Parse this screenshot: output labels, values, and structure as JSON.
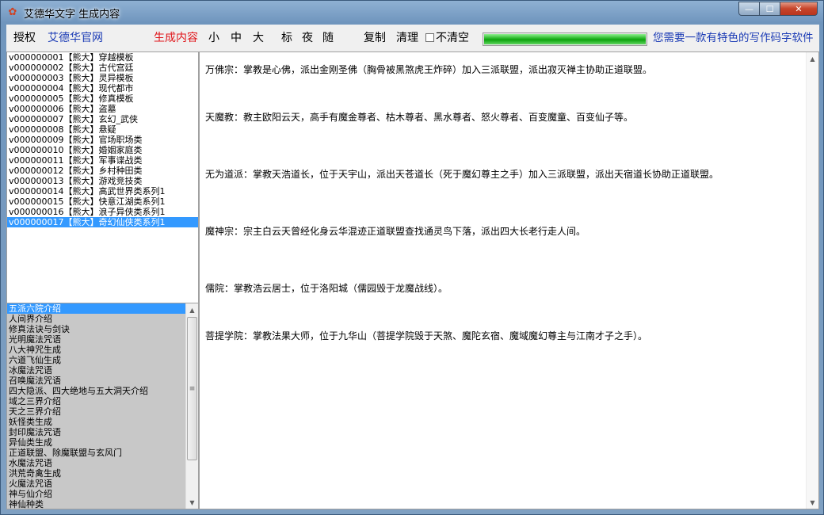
{
  "window": {
    "title": "艾德华文字 生成内容",
    "app_icon": "app-icon",
    "controls": {
      "minimize": "—",
      "maximize": "☐",
      "close": "✕"
    }
  },
  "toolbar": {
    "authorize": "授权",
    "official_site": "艾德华官网",
    "generate": "生成内容",
    "size_small": "小",
    "size_medium": "中",
    "size_large": "大",
    "mode_standard": "标",
    "mode_night": "夜",
    "mode_random": "随",
    "copy": "复制",
    "clear": "清理",
    "no_clear": "不清空",
    "no_clear_checked": false,
    "progress_fraction": 1.0,
    "slogan": "您需要一款有特色的写作码字软件"
  },
  "templates": [
    "v000000001【熊大】穿越模板",
    "v000000002【熊大】古代宫廷",
    "v000000003【熊大】灵异模板",
    "v000000004【熊大】现代都市",
    "v000000005【熊大】修真模板",
    "v000000006【熊大】盗墓",
    "v000000007【熊大】玄幻_武侠",
    "v000000008【熊大】悬疑",
    "v000000009【熊大】官场职场类",
    "v000000010【熊大】婚姻家庭类",
    "v000000011【熊大】军事谍战类",
    "v000000012【熊大】乡村种田类",
    "v000000013【熊大】游戏竞技类",
    "v000000014【熊大】高武世界类系列1",
    "v000000015【熊大】快意江湖类系列1",
    "v000000016【熊大】浪子异侠类系列1",
    "v000000017【熊大】奇幻仙侠类系列1"
  ],
  "templates_selected": 16,
  "topics": [
    "五派六院介绍",
    "人间界介绍",
    "修真法诀与剑诀",
    "光明魔法咒语",
    "八大神咒生成",
    "六道飞仙生成",
    "冰魔法咒语",
    "召唤魔法咒语",
    "四大隐派、四大绝地与五大洞天介绍",
    "域之三界介绍",
    "天之三界介绍",
    "妖怪类生成",
    "封印魔法咒语",
    "异仙类生成",
    "正道联盟、除魔联盟与玄风门",
    "水魔法咒语",
    "洪荒奇禽生成",
    "火魔法咒语",
    "神与仙介绍",
    "神仙种类"
  ],
  "topics_selected": 0,
  "content": [
    "万佛宗：掌教是心佛，派出金刚圣佛（胸骨被黑煞虎王炸碎）加入三派联盟，派出寂灭禅主协助正道联盟。",
    "天魔教：教主欧阳云天，高手有魔金尊者、枯木尊者、黑水尊者、怒火尊者、百变魔童、百变仙子等。",
    "无为道派：掌教天浩道长，位于天宇山，派出天苍道长（死于魔幻尊主之手）加入三派联盟，派出天宿道长协助正道联盟。",
    "魔神宗：宗主白云天曾经化身云华混迹正道联盟查找通灵鸟下落，派出四大长老行走人间。",
    "儒院：掌教浩云居士，位于洛阳城（儒园毁于龙魔战线）。",
    "菩提学院：掌教法果大师，位于九华山（菩提学院毁于天煞、魔陀玄宿、魔域魔幻尊主与江南才子之手）。"
  ],
  "colors": {
    "link_blue": "#1b3bb5",
    "accent_red": "#e0151a",
    "selection": "#3399ff",
    "progress_green": "#21b221"
  }
}
